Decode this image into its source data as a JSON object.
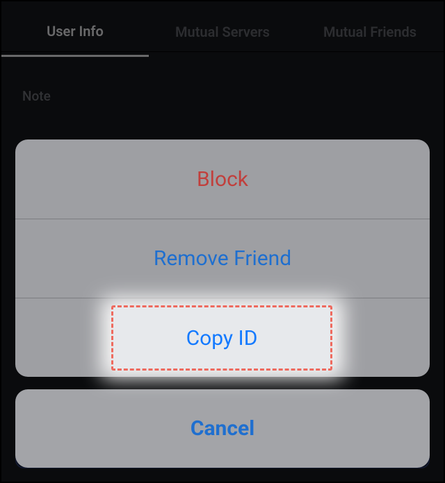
{
  "tabs": {
    "items": [
      {
        "label": "User Info",
        "active": true
      },
      {
        "label": "Mutual Servers",
        "active": false
      },
      {
        "label": "Mutual Friends",
        "active": false
      }
    ]
  },
  "note_section": {
    "label": "Note"
  },
  "action_sheet": {
    "block": "Block",
    "remove_friend": "Remove Friend",
    "copy_id": "Copy ID",
    "cancel": "Cancel"
  },
  "highlight": {
    "target": "copy-id"
  }
}
